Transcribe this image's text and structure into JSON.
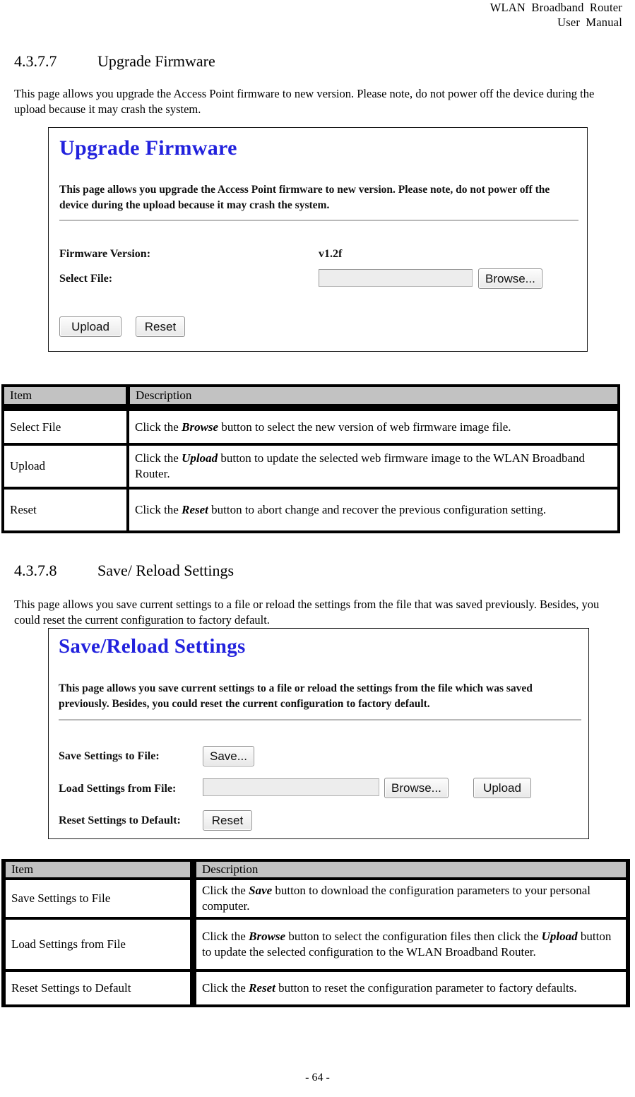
{
  "running_head": {
    "line1": "WLAN  Broadband  Router",
    "line2": "User  Manual"
  },
  "sections": [
    {
      "number": "4.3.7.7",
      "title": "Upgrade Firmware",
      "intro": "This page allows you upgrade the Access Point firmware to new version. Please note, do not power off the device during the upload because it may crash the system."
    },
    {
      "number": "4.3.7.8",
      "title": "Save/ Reload Settings",
      "intro": "This page allows you save current settings to a file or reload the settings from the file that was saved previously. Besides, you could reset the current configuration to factory default."
    }
  ],
  "screenshot_upgrade": {
    "title": "Upgrade Firmware",
    "title_color": "#2222dd",
    "description": "This page allows you upgrade the Access Point firmware to new version. Please note, do not power off the device during the upload because it may crash the system.",
    "firmware_version_label": "Firmware Version:",
    "firmware_version_value": "v1.2f",
    "select_file_label": "Select File:",
    "select_file_value": "",
    "browse_button": "Browse...",
    "upload_button": "Upload",
    "reset_button": "Reset"
  },
  "screenshot_savereload": {
    "title": "Save/Reload Settings",
    "title_color": "#2222dd",
    "description": "This page allows you save current settings to a file or reload the settings from the file which was saved previously. Besides, you could reset the current configuration to factory default.",
    "save_settings_label": "Save Settings to File:",
    "save_button": "Save...",
    "load_settings_label": "Load Settings from File:",
    "load_settings_value": "",
    "browse_button": "Browse...",
    "upload_button": "Upload",
    "reset_settings_label": "Reset Settings to Default:",
    "reset_button": "Reset"
  },
  "table_upgrade": {
    "headers": [
      "Item",
      "Description"
    ],
    "rows": [
      {
        "item": "Select File",
        "desc_pre": "Click the ",
        "desc_bold": "Browse",
        "desc_post": " button to select the new version of web firmware image file."
      },
      {
        "item": "Upload",
        "desc_pre": "Click the ",
        "desc_bold": "Upload",
        "desc_post": " button to update the selected web firmware image to the WLAN Broadband Router."
      },
      {
        "item": "Reset",
        "desc_pre": "Click the ",
        "desc_bold": "Reset",
        "desc_post": " button to abort change and recover the previous configuration setting."
      }
    ]
  },
  "table_savereload": {
    "headers": [
      "Item",
      "Description"
    ],
    "rows": [
      {
        "item": "Save Settings to File",
        "desc_pre": "Click the ",
        "desc_bold": "Save",
        "desc_post": " button to download the configuration parameters to your personal computer.",
        "desc_bold2": "",
        "desc_post2": ""
      },
      {
        "item": "Load Settings from File",
        "desc_pre": "Click the ",
        "desc_bold": "Browse",
        "desc_post": " button to select the configuration files then click the ",
        "desc_bold2": "Upload",
        "desc_post2": " button to update the selected configuration to the WLAN Broadband Router."
      },
      {
        "item": "Reset Settings to Default",
        "desc_pre": "Click the ",
        "desc_bold": "Reset",
        "desc_post": " button to reset the configuration parameter to factory defaults.",
        "desc_bold2": "",
        "desc_post2": ""
      }
    ]
  },
  "footer": {
    "page_number": "- 64 -"
  }
}
